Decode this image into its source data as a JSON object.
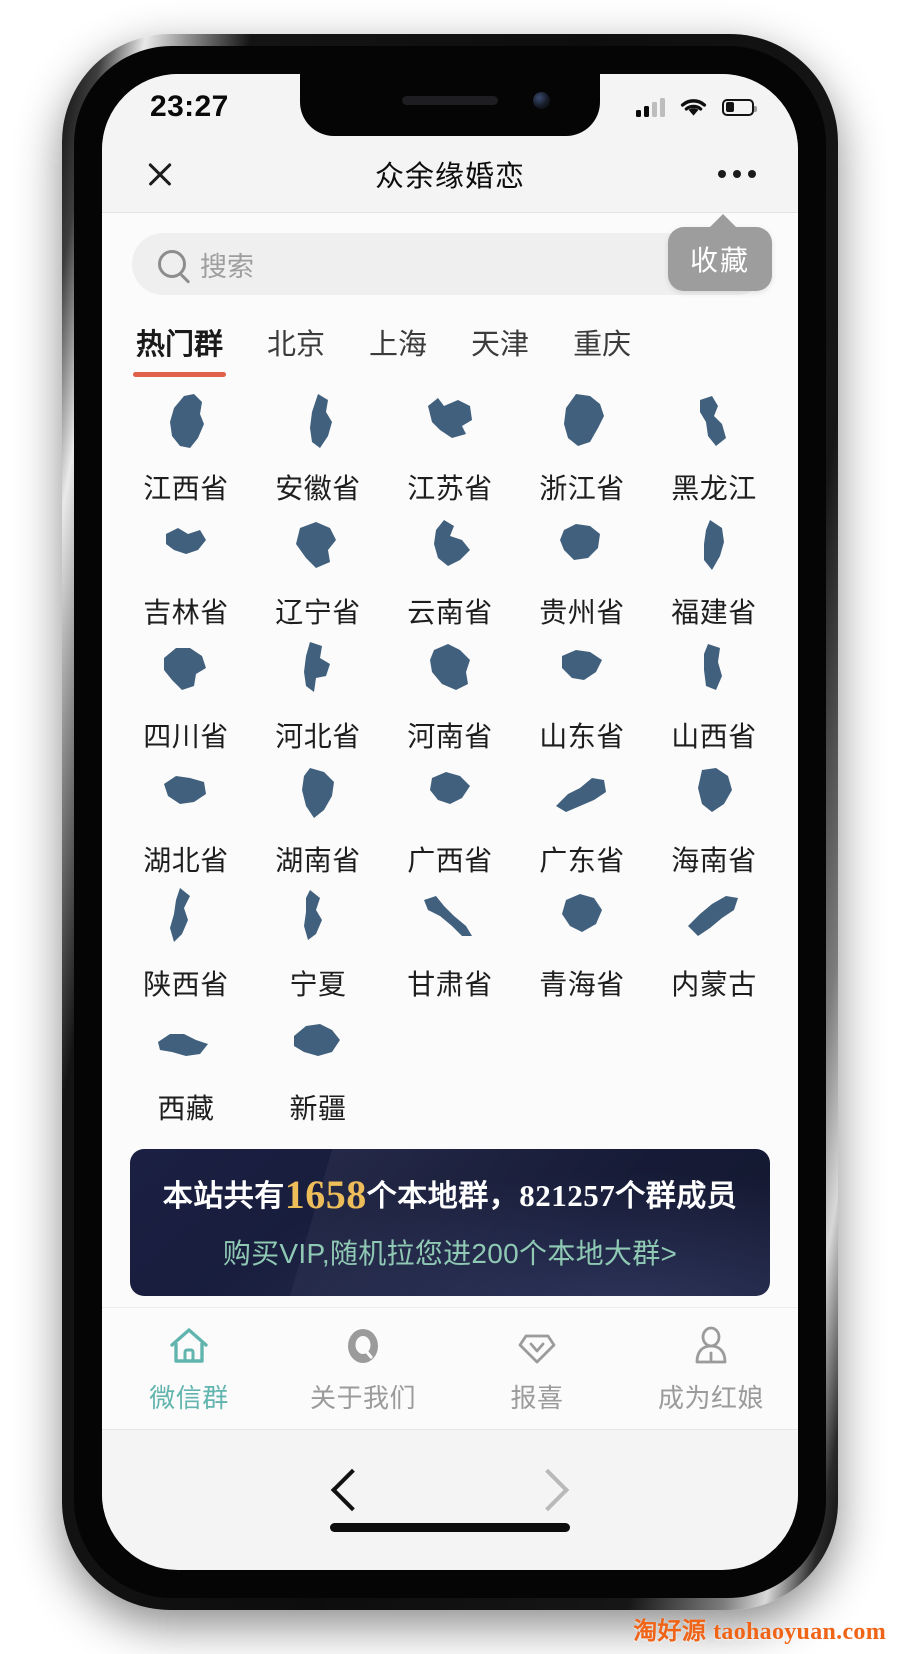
{
  "status_bar": {
    "time": "23:27",
    "signal_icon": "signal-bars-icon",
    "wifi_icon": "wifi-icon",
    "battery_icon": "battery-low-icon"
  },
  "wechat_nav": {
    "close_icon": "close-icon",
    "title": "众余缘婚恋",
    "more_icon": "more-dots-icon"
  },
  "search": {
    "icon": "search-icon",
    "placeholder": "搜索",
    "value": ""
  },
  "favorite_bubble": {
    "label": "收藏"
  },
  "tabs": [
    {
      "label": "热门群",
      "active": true
    },
    {
      "label": "北京",
      "active": false
    },
    {
      "label": "上海",
      "active": false
    },
    {
      "label": "天津",
      "active": false
    },
    {
      "label": "重庆",
      "active": false
    }
  ],
  "provinces": [
    {
      "name": "江西省"
    },
    {
      "name": "安徽省"
    },
    {
      "name": "江苏省"
    },
    {
      "name": "浙江省"
    },
    {
      "name": "黑龙江"
    },
    {
      "name": "吉林省"
    },
    {
      "name": "辽宁省"
    },
    {
      "name": "云南省"
    },
    {
      "name": "贵州省"
    },
    {
      "name": "福建省"
    },
    {
      "name": "四川省"
    },
    {
      "name": "河北省"
    },
    {
      "name": "河南省"
    },
    {
      "name": "山东省"
    },
    {
      "name": "山西省"
    },
    {
      "name": "湖北省"
    },
    {
      "name": "湖南省"
    },
    {
      "name": "广西省"
    },
    {
      "name": "广东省"
    },
    {
      "name": "海南省"
    },
    {
      "name": "陕西省"
    },
    {
      "name": "宁夏"
    },
    {
      "name": "甘肃省"
    },
    {
      "name": "青海省"
    },
    {
      "name": "内蒙古"
    },
    {
      "name": "西藏"
    },
    {
      "name": "新疆"
    }
  ],
  "stats_banner": {
    "prefix": "本站共有",
    "group_count": "1658",
    "middle": "个本地群，",
    "member_count": "821257",
    "suffix": "个群成员",
    "vip_line": "购买VIP,随机拉您进200个本地大群>",
    "accent_color": "#edbd5a",
    "vip_color": "#8fc9b4",
    "background_color": "#1b2043"
  },
  "site_nav": [
    {
      "label": "微信群",
      "icon": "home-icon",
      "active": true
    },
    {
      "label": "关于我们",
      "icon": "info-circle-icon",
      "active": false
    },
    {
      "label": "报喜",
      "icon": "diamond-check-icon",
      "active": false
    },
    {
      "label": "成为红娘",
      "icon": "user-icon",
      "active": false
    }
  ],
  "browser_bar": {
    "back_icon": "chevron-left-icon",
    "forward_icon": "chevron-right-icon"
  },
  "watermark": {
    "cn": "淘好源",
    "en": "taohaoyuan.com",
    "color": "#ef6417"
  }
}
